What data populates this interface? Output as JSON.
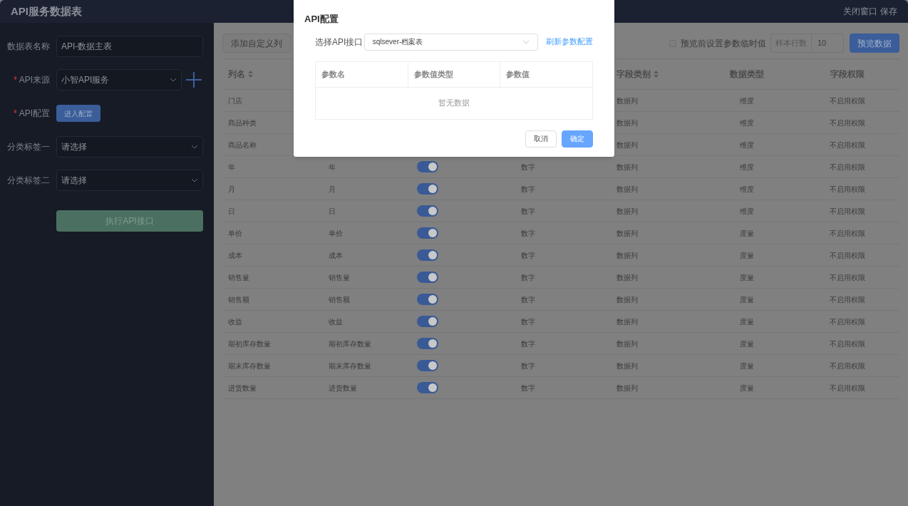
{
  "window": {
    "title": "API服务数据表",
    "actions": [
      "关闭窗口",
      "保存"
    ]
  },
  "form": {
    "fields": [
      {
        "kind": "input",
        "label": "数据表名称",
        "required": false,
        "value": "API-数据主表"
      },
      {
        "kind": "select",
        "label": "API来源",
        "required": true,
        "value": "小智API服务",
        "add": true
      },
      {
        "kind": "button",
        "label": "API配置",
        "required": true,
        "button": "进入配置"
      },
      {
        "kind": "select",
        "label": "分类标签一",
        "required": false,
        "placeholder": "请选择",
        "add": false
      },
      {
        "kind": "select",
        "label": "分类标签二",
        "required": false,
        "placeholder": "请选择",
        "add": false
      }
    ],
    "submit": "执行API接口"
  },
  "toolbar": {
    "add_column": "添加自定义列",
    "temp_param": {
      "label": "预览前设置参数临时值",
      "checked": false
    },
    "sample_rows": {
      "label": "样本行数",
      "value": "10"
    },
    "preview": "预览数据"
  },
  "table": {
    "columns": [
      {
        "label": "列名",
        "sortable": true
      },
      {},
      {},
      {},
      {
        "label": "字段类别",
        "sortable": true
      },
      {
        "label": "数据类型",
        "sortable": false
      },
      {
        "label": "字段权限",
        "sortable": false
      }
    ],
    "rows": [
      {
        "name": "门店",
        "category": "数据列",
        "data_type": "维度",
        "permission": "不启用权限"
      },
      {
        "name": "商品种类",
        "category": "数据列",
        "data_type": "维度",
        "permission": "不启用权限"
      },
      {
        "name": "商品名称",
        "category": "数据列",
        "data_type": "维度",
        "permission": "不启用权限"
      },
      {
        "name": "年",
        "alias": "年",
        "on": true,
        "value_type": "数字",
        "category": "数据列",
        "data_type": "维度",
        "permission": "不启用权限"
      },
      {
        "name": "月",
        "alias": "月",
        "on": true,
        "value_type": "数字",
        "category": "数据列",
        "data_type": "维度",
        "permission": "不启用权限"
      },
      {
        "name": "日",
        "alias": "日",
        "on": true,
        "value_type": "数字",
        "category": "数据列",
        "data_type": "维度",
        "permission": "不启用权限"
      },
      {
        "name": "单价",
        "alias": "单价",
        "on": true,
        "value_type": "数字",
        "category": "数据列",
        "data_type": "度量",
        "permission": "不启用权限"
      },
      {
        "name": "成本",
        "alias": "成本",
        "on": true,
        "value_type": "数字",
        "category": "数据列",
        "data_type": "度量",
        "permission": "不启用权限"
      },
      {
        "name": "销售量",
        "alias": "销售量",
        "on": true,
        "value_type": "数字",
        "category": "数据列",
        "data_type": "度量",
        "permission": "不启用权限"
      },
      {
        "name": "销售额",
        "alias": "销售额",
        "on": true,
        "value_type": "数字",
        "category": "数据列",
        "data_type": "度量",
        "permission": "不启用权限"
      },
      {
        "name": "收益",
        "alias": "收益",
        "on": true,
        "value_type": "数字",
        "category": "数据列",
        "data_type": "度量",
        "permission": "不启用权限"
      },
      {
        "name": "期初库存数量",
        "alias": "期初库存数量",
        "on": true,
        "value_type": "数字",
        "category": "数据列",
        "data_type": "度量",
        "permission": "不启用权限"
      },
      {
        "name": "期末库存数量",
        "alias": "期末库存数量",
        "on": true,
        "value_type": "数字",
        "category": "数据列",
        "data_type": "度量",
        "permission": "不启用权限"
      },
      {
        "name": "进货数量",
        "alias": "进货数量",
        "on": true,
        "value_type": "数字",
        "category": "数据列",
        "data_type": "度量",
        "permission": "不启用权限"
      }
    ]
  },
  "dialog": {
    "title": "API配置",
    "select_label": "选择API接口",
    "select_value": "sqlsever-档案表",
    "refresh": "刷新参数配置",
    "columns": [
      "参数名",
      "参数值类型",
      "参数值"
    ],
    "empty": "暂无数据",
    "buttons": [
      {
        "kind": "secondary",
        "label": "取消"
      },
      {
        "kind": "primary",
        "label": "确定"
      }
    ]
  }
}
